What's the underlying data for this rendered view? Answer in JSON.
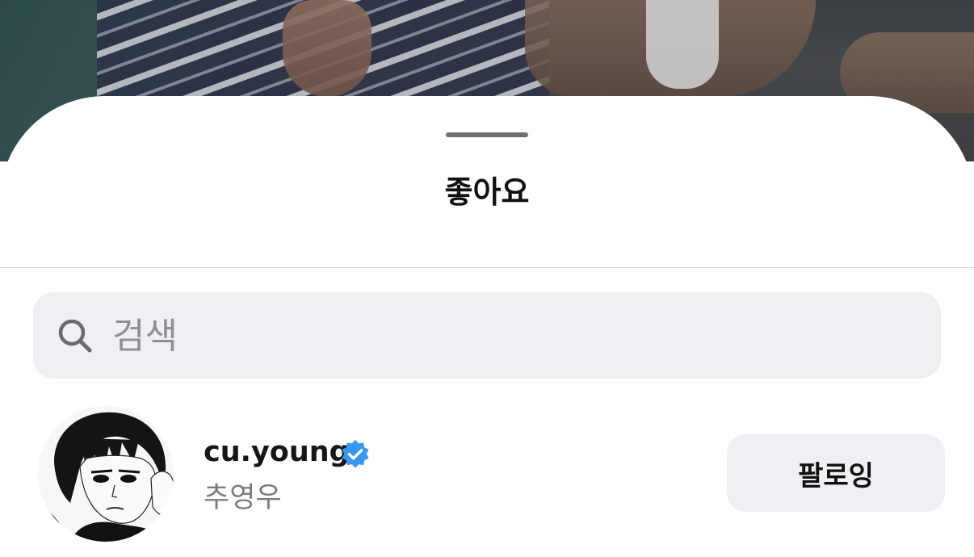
{
  "sheet": {
    "title": "좋아요"
  },
  "search": {
    "placeholder": "검색",
    "value": ""
  },
  "likes": [
    {
      "username": "cu.young",
      "full_name": "추영우",
      "verified": true,
      "button_label": "팔로잉"
    }
  ],
  "colors": {
    "verified_badge": "#3897f0",
    "search_bg": "#eff0f3",
    "button_bg": "#eff0f3",
    "secondary_text": "#7b7c80"
  }
}
